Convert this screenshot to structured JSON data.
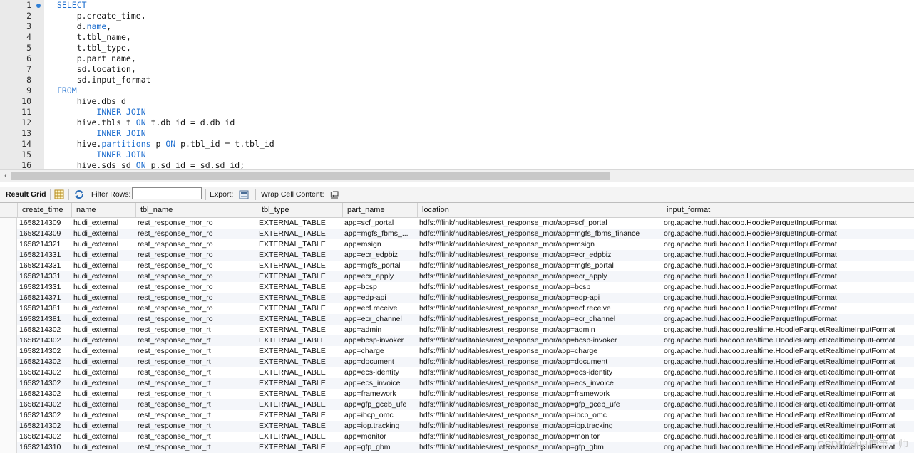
{
  "editor": {
    "lines": [
      {
        "num": "1",
        "marker": true,
        "tokens": [
          {
            "t": "SELECT",
            "k": true
          }
        ]
      },
      {
        "num": "2",
        "tokens": [
          {
            "t": "    p.create_time,"
          }
        ]
      },
      {
        "num": "3",
        "tokens": [
          {
            "t": "    d."
          },
          {
            "t": "name",
            "k": true
          },
          {
            "t": ","
          }
        ]
      },
      {
        "num": "4",
        "tokens": [
          {
            "t": "    t.tbl_name,"
          }
        ]
      },
      {
        "num": "5",
        "tokens": [
          {
            "t": "    t.tbl_type,"
          }
        ]
      },
      {
        "num": "6",
        "tokens": [
          {
            "t": "    p.part_name,"
          }
        ]
      },
      {
        "num": "7",
        "tokens": [
          {
            "t": "    sd.location,"
          }
        ]
      },
      {
        "num": "8",
        "tokens": [
          {
            "t": "    sd.input_format"
          }
        ]
      },
      {
        "num": "9",
        "tokens": [
          {
            "t": "FROM",
            "k": true
          }
        ]
      },
      {
        "num": "10",
        "tokens": [
          {
            "t": "    hive.dbs d"
          }
        ]
      },
      {
        "num": "11",
        "tokens": [
          {
            "t": "        "
          },
          {
            "t": "INNER JOIN",
            "k": true
          }
        ]
      },
      {
        "num": "12",
        "tokens": [
          {
            "t": "    hive.tbls t "
          },
          {
            "t": "ON",
            "k": true
          },
          {
            "t": " t.db_id = d.db_id"
          }
        ]
      },
      {
        "num": "13",
        "tokens": [
          {
            "t": "        "
          },
          {
            "t": "INNER JOIN",
            "k": true
          }
        ]
      },
      {
        "num": "14",
        "tokens": [
          {
            "t": "    hive."
          },
          {
            "t": "partitions",
            "k": true
          },
          {
            "t": " p "
          },
          {
            "t": "ON",
            "k": true
          },
          {
            "t": " p.tbl_id = t.tbl_id"
          }
        ]
      },
      {
        "num": "15",
        "tokens": [
          {
            "t": "        "
          },
          {
            "t": "INNER JOIN",
            "k": true
          }
        ]
      },
      {
        "num": "16",
        "tokens": [
          {
            "t": "    hive.sds sd "
          },
          {
            "t": "ON",
            "k": true
          },
          {
            "t": " p.sd_id = sd.sd_id;"
          }
        ]
      }
    ]
  },
  "toolbar": {
    "result_grid_label": "Result Grid",
    "filter_rows_label": "Filter Rows:",
    "filter_rows_value": "",
    "export_label": "Export:",
    "wrap_cell_label": "Wrap Cell Content:"
  },
  "grid": {
    "columns": [
      "create_time",
      "name",
      "tbl_name",
      "tbl_type",
      "part_name",
      "location",
      "input_format"
    ],
    "rows": [
      [
        "1658214309",
        "hudi_external",
        "rest_response_mor_ro",
        "EXTERNAL_TABLE",
        "app=scf_portal",
        "hdfs://flink/huditables/rest_response_mor/app=scf_portal",
        "org.apache.hudi.hadoop.HoodieParquetInputFormat"
      ],
      [
        "1658214309",
        "hudi_external",
        "rest_response_mor_ro",
        "EXTERNAL_TABLE",
        "app=mgfs_fbms_...",
        "hdfs://flink/huditables/rest_response_mor/app=mgfs_fbms_finance",
        "org.apache.hudi.hadoop.HoodieParquetInputFormat"
      ],
      [
        "1658214321",
        "hudi_external",
        "rest_response_mor_ro",
        "EXTERNAL_TABLE",
        "app=msign",
        "hdfs://flink/huditables/rest_response_mor/app=msign",
        "org.apache.hudi.hadoop.HoodieParquetInputFormat"
      ],
      [
        "1658214331",
        "hudi_external",
        "rest_response_mor_ro",
        "EXTERNAL_TABLE",
        "app=ecr_edpbiz",
        "hdfs://flink/huditables/rest_response_mor/app=ecr_edpbiz",
        "org.apache.hudi.hadoop.HoodieParquetInputFormat"
      ],
      [
        "1658214331",
        "hudi_external",
        "rest_response_mor_ro",
        "EXTERNAL_TABLE",
        "app=mgfs_portal",
        "hdfs://flink/huditables/rest_response_mor/app=mgfs_portal",
        "org.apache.hudi.hadoop.HoodieParquetInputFormat"
      ],
      [
        "1658214331",
        "hudi_external",
        "rest_response_mor_ro",
        "EXTERNAL_TABLE",
        "app=ecr_apply",
        "hdfs://flink/huditables/rest_response_mor/app=ecr_apply",
        "org.apache.hudi.hadoop.HoodieParquetInputFormat"
      ],
      [
        "1658214331",
        "hudi_external",
        "rest_response_mor_ro",
        "EXTERNAL_TABLE",
        "app=bcsp",
        "hdfs://flink/huditables/rest_response_mor/app=bcsp",
        "org.apache.hudi.hadoop.HoodieParquetInputFormat"
      ],
      [
        "1658214371",
        "hudi_external",
        "rest_response_mor_ro",
        "EXTERNAL_TABLE",
        "app=edp-api",
        "hdfs://flink/huditables/rest_response_mor/app=edp-api",
        "org.apache.hudi.hadoop.HoodieParquetInputFormat"
      ],
      [
        "1658214381",
        "hudi_external",
        "rest_response_mor_ro",
        "EXTERNAL_TABLE",
        "app=ecf.receive",
        "hdfs://flink/huditables/rest_response_mor/app=ecf.receive",
        "org.apache.hudi.hadoop.HoodieParquetInputFormat"
      ],
      [
        "1658214381",
        "hudi_external",
        "rest_response_mor_ro",
        "EXTERNAL_TABLE",
        "app=ecr_channel",
        "hdfs://flink/huditables/rest_response_mor/app=ecr_channel",
        "org.apache.hudi.hadoop.HoodieParquetInputFormat"
      ],
      [
        "1658214302",
        "hudi_external",
        "rest_response_mor_rt",
        "EXTERNAL_TABLE",
        "app=admin",
        "hdfs://flink/huditables/rest_response_mor/app=admin",
        "org.apache.hudi.hadoop.realtime.HoodieParquetRealtimeInputFormat"
      ],
      [
        "1658214302",
        "hudi_external",
        "rest_response_mor_rt",
        "EXTERNAL_TABLE",
        "app=bcsp-invoker",
        "hdfs://flink/huditables/rest_response_mor/app=bcsp-invoker",
        "org.apache.hudi.hadoop.realtime.HoodieParquetRealtimeInputFormat"
      ],
      [
        "1658214302",
        "hudi_external",
        "rest_response_mor_rt",
        "EXTERNAL_TABLE",
        "app=charge",
        "hdfs://flink/huditables/rest_response_mor/app=charge",
        "org.apache.hudi.hadoop.realtime.HoodieParquetRealtimeInputFormat"
      ],
      [
        "1658214302",
        "hudi_external",
        "rest_response_mor_rt",
        "EXTERNAL_TABLE",
        "app=document",
        "hdfs://flink/huditables/rest_response_mor/app=document",
        "org.apache.hudi.hadoop.realtime.HoodieParquetRealtimeInputFormat"
      ],
      [
        "1658214302",
        "hudi_external",
        "rest_response_mor_rt",
        "EXTERNAL_TABLE",
        "app=ecs-identity",
        "hdfs://flink/huditables/rest_response_mor/app=ecs-identity",
        "org.apache.hudi.hadoop.realtime.HoodieParquetRealtimeInputFormat"
      ],
      [
        "1658214302",
        "hudi_external",
        "rest_response_mor_rt",
        "EXTERNAL_TABLE",
        "app=ecs_invoice",
        "hdfs://flink/huditables/rest_response_mor/app=ecs_invoice",
        "org.apache.hudi.hadoop.realtime.HoodieParquetRealtimeInputFormat"
      ],
      [
        "1658214302",
        "hudi_external",
        "rest_response_mor_rt",
        "EXTERNAL_TABLE",
        "app=framework",
        "hdfs://flink/huditables/rest_response_mor/app=framework",
        "org.apache.hudi.hadoop.realtime.HoodieParquetRealtimeInputFormat"
      ],
      [
        "1658214302",
        "hudi_external",
        "rest_response_mor_rt",
        "EXTERNAL_TABLE",
        "app=gfp_gceb_ufe",
        "hdfs://flink/huditables/rest_response_mor/app=gfp_gceb_ufe",
        "org.apache.hudi.hadoop.realtime.HoodieParquetRealtimeInputFormat"
      ],
      [
        "1658214302",
        "hudi_external",
        "rest_response_mor_rt",
        "EXTERNAL_TABLE",
        "app=ibcp_omc",
        "hdfs://flink/huditables/rest_response_mor/app=ibcp_omc",
        "org.apache.hudi.hadoop.realtime.HoodieParquetRealtimeInputFormat"
      ],
      [
        "1658214302",
        "hudi_external",
        "rest_response_mor_rt",
        "EXTERNAL_TABLE",
        "app=iop.tracking",
        "hdfs://flink/huditables/rest_response_mor/app=iop.tracking",
        "org.apache.hudi.hadoop.realtime.HoodieParquetRealtimeInputFormat"
      ],
      [
        "1658214302",
        "hudi_external",
        "rest_response_mor_rt",
        "EXTERNAL_TABLE",
        "app=monitor",
        "hdfs://flink/huditables/rest_response_mor/app=monitor",
        "org.apache.hudi.hadoop.realtime.HoodieParquetRealtimeInputFormat"
      ],
      [
        "1658214310",
        "hudi_external",
        "rest_response_mor_rt",
        "EXTERNAL_TABLE",
        "app=gfp_gbm",
        "hdfs://flink/huditables/rest_response_mor/app=gfp_gbm",
        "org.apache.hudi.hadoop.realtime.HoodieParquetRealtimeInputFormat"
      ]
    ]
  },
  "watermark": "CSDN @白鹿第一帅",
  "colors": {
    "keyword": "#1f6fcf",
    "gutter": "#eaeaea",
    "row_alt": "#f4f6fa"
  }
}
